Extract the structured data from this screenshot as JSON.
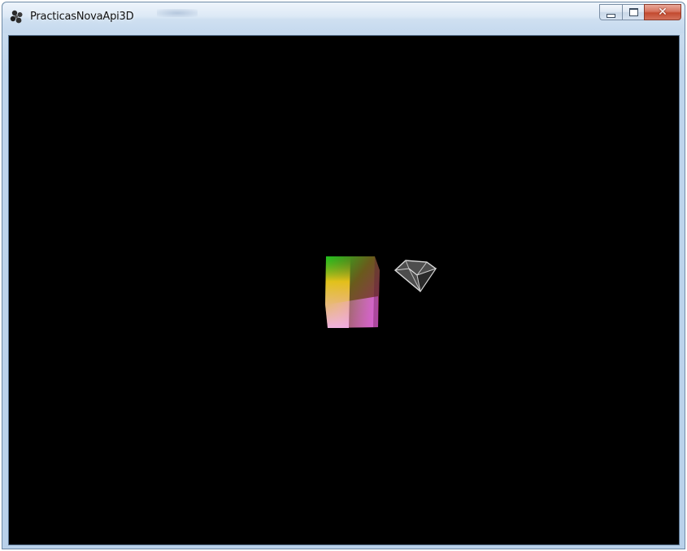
{
  "window": {
    "title": "PracticasNovaApi3D"
  },
  "titlebar": {
    "icon": "app-icon",
    "buttons": {
      "minimize": "minimize-icon",
      "maximize": "maximize-icon",
      "close": "close-icon",
      "close_glyph": "✕"
    }
  },
  "viewport": {
    "background_color": "#000000",
    "objects": [
      {
        "name": "color-gradient-cube",
        "colors": [
          "#1ec41e",
          "#f2c81a",
          "#a0236e",
          "#e76af0"
        ]
      },
      {
        "name": "wireframe-diamond",
        "color": "#b9b9b9"
      }
    ]
  },
  "colors": {
    "titlebar": "#c5d9ee",
    "close_button": "#c24a2f",
    "viewport": "#000000"
  }
}
